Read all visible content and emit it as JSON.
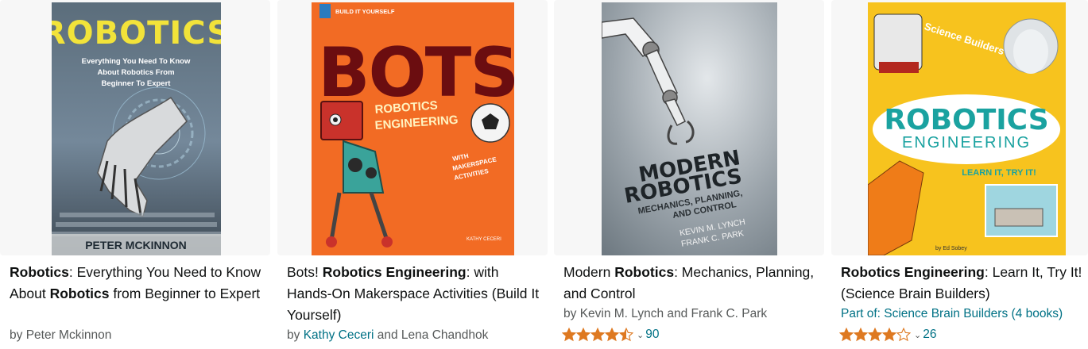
{
  "books": [
    {
      "cover": {
        "title": "ROBOTICS",
        "subtitle_lines": [
          "Everything You Need To Know",
          "About Robotics From",
          "Beginner To Expert"
        ],
        "author": "PETER MCKINNON"
      },
      "title_parts": [
        {
          "t": "Robotics",
          "b": true
        },
        {
          "t": ": Everything You Need to Know About ",
          "b": false
        },
        {
          "t": "Robotics",
          "b": true
        },
        {
          "t": " from Beginner to Expert",
          "b": false
        }
      ],
      "byline_prefix": "by ",
      "author": "Peter Mckinnon"
    },
    {
      "cover": {
        "series": "BUILD IT YOURSELF",
        "title": "BOTS!",
        "subtitle_lines": [
          "ROBOTICS",
          "ENGINEERING"
        ],
        "tagline_lines": [
          "WITH",
          "MAKERSPACE",
          "ACTIVITIES"
        ],
        "author": "KATHY CECERI"
      },
      "title_parts": [
        {
          "t": "Bots! ",
          "b": false
        },
        {
          "t": "Robotics Engineering",
          "b": true
        },
        {
          "t": ": with Hands-On Makerspace Activities (Build It Yourself)",
          "b": false
        }
      ],
      "byline_prefix": "by ",
      "author_link": "Kathy Ceceri",
      "author_sep": " and ",
      "author2": "Lena Chandhok"
    },
    {
      "cover": {
        "title_lines": [
          "MODERN",
          "ROBOTICS"
        ],
        "subtitle_lines": [
          "MECHANICS, PLANNING,",
          "AND CONTROL"
        ],
        "author_lines": [
          "KEVIN M. LYNCH",
          "FRANK C. PARK"
        ]
      },
      "title_parts": [
        {
          "t": "Modern ",
          "b": false
        },
        {
          "t": "Robotics",
          "b": true
        },
        {
          "t": ": Mechanics, Planning, and Control",
          "b": false
        }
      ],
      "byline_prefix": "by ",
      "author": "Kevin M. Lynch and Frank C. Park",
      "rating": 4.5,
      "review_count": "90"
    },
    {
      "cover": {
        "series": "Science Builders",
        "title_lines": [
          "ROBOTICS",
          "ENGINEERING"
        ],
        "tagline": "LEARN IT, TRY IT!",
        "author": "by Ed Sobey"
      },
      "title_parts": [
        {
          "t": "Robotics Engineering",
          "b": true
        },
        {
          "t": ": Learn It, Try It! (Science Brain Builders)",
          "b": false
        }
      ],
      "part_of": "Part of: Science Brain Builders (4 books)",
      "rating": 4.0,
      "review_count": "26"
    }
  ],
  "colors": {
    "link": "#007185",
    "star": "#de7921",
    "secondary_text": "#565959"
  },
  "icons": {
    "star": "star-icon",
    "chevron": "chevron-down-icon"
  }
}
